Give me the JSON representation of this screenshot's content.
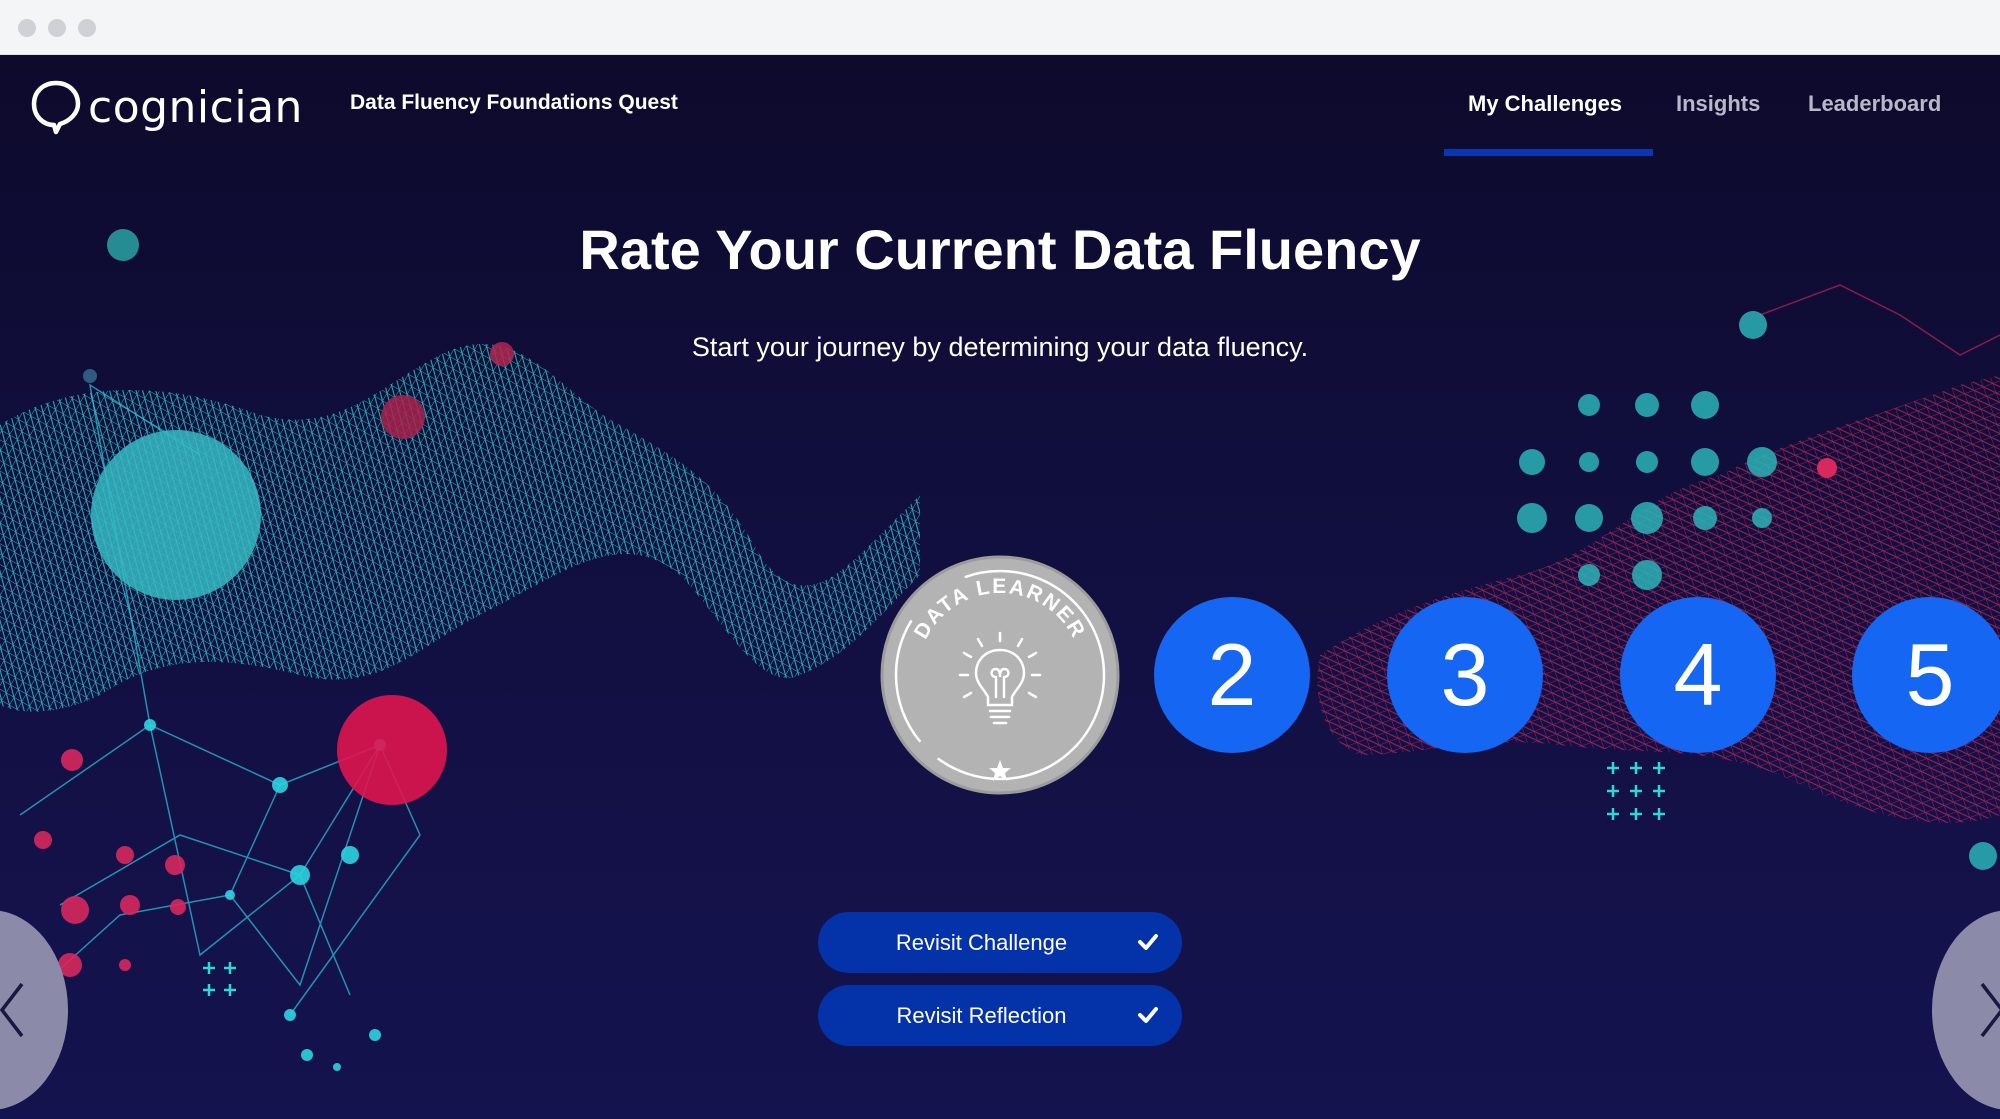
{
  "browser": {
    "window_controls": [
      "close",
      "minimize",
      "maximize"
    ]
  },
  "header": {
    "logo_text": "cognician",
    "quest_title": "Data Fluency Foundations Quest",
    "nav": [
      {
        "label": "My Challenges",
        "active": true
      },
      {
        "label": "Insights",
        "active": false
      },
      {
        "label": "Leaderboard",
        "active": false
      }
    ]
  },
  "main": {
    "title": "Rate Your Current Data Fluency",
    "subtitle": "Start your journey by determining your data fluency.",
    "badge": {
      "label": "DATA LEARNER",
      "icon": "lightbulb-icon",
      "level": 1,
      "state": "completed"
    },
    "levels": [
      {
        "label": "2"
      },
      {
        "label": "3"
      },
      {
        "label": "4"
      },
      {
        "label": "5"
      }
    ],
    "buttons": [
      {
        "label": "Revisit Challenge",
        "icon": "check-icon"
      },
      {
        "label": "Revisit Reflection",
        "icon": "check-icon"
      }
    ],
    "carousel": {
      "prev_icon": "chevron-left-icon",
      "next_icon": "chevron-right-icon"
    }
  },
  "colors": {
    "background": "#0e0b30",
    "accent_blue": "#1466f3",
    "button_blue": "#0432a8",
    "nav_underline": "#0a36b2",
    "badge_gray": "#b3b3b3",
    "teal": "#1fd6cf",
    "pink": "#d8285c"
  }
}
